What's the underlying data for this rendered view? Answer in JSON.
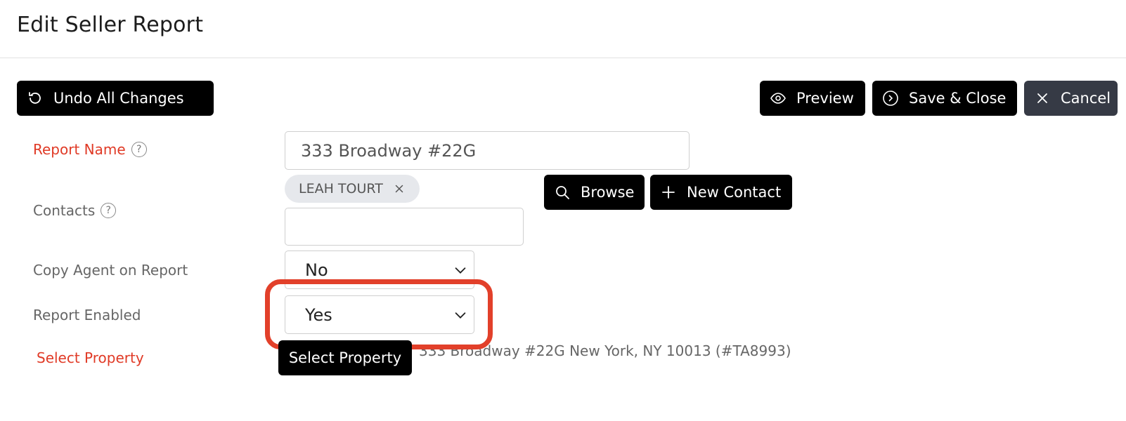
{
  "header": {
    "title": "Edit Seller Report"
  },
  "toolbar": {
    "undo_label": "Undo All Changes",
    "preview_label": "Preview",
    "save_close_label": "Save & Close",
    "cancel_label": "Cancel"
  },
  "form": {
    "report_name": {
      "label": "Report Name",
      "value": "333 Broadway #22G"
    },
    "contacts": {
      "label": "Contacts",
      "chips": [
        "LEAH TOURT"
      ],
      "input_value": "",
      "browse_label": "Browse",
      "new_contact_label": "New Contact"
    },
    "copy_agent": {
      "label": "Copy Agent on Report",
      "selected": "No"
    },
    "report_enabled": {
      "label": "Report Enabled",
      "selected": "Yes"
    },
    "select_property": {
      "label": "Select Property",
      "button_label": "Select Property",
      "value": "333 Broadway #22G New York, NY 10013 (#TA8993)"
    }
  },
  "colors": {
    "required_label": "#e03a26",
    "highlight": "#e2402a",
    "button_bg": "#000000",
    "cancel_bg": "#363a45"
  }
}
